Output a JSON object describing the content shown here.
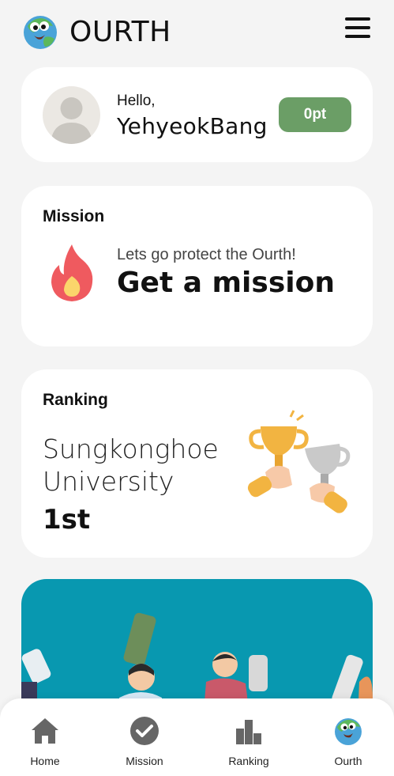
{
  "header": {
    "title": "OURTH",
    "logo_icon": "earth-mascot-icon",
    "menu_icon": "hamburger-menu-icon"
  },
  "profile": {
    "greeting": "Hello,",
    "username": "YehyeokBang",
    "points": "0pt",
    "avatar_icon": "default-avatar-icon"
  },
  "mission": {
    "heading": "Mission",
    "subtitle": "Lets go protect the Ourth!",
    "cta": "Get a mission",
    "icon": "fire-icon"
  },
  "ranking": {
    "heading": "Ranking",
    "school_line1": "Sungkonghoe",
    "school_line2": "University",
    "position": "1st",
    "icon": "trophies-icon"
  },
  "nav": {
    "items": [
      {
        "label": "Home",
        "icon": "home-icon"
      },
      {
        "label": "Mission",
        "icon": "check-circle-icon"
      },
      {
        "label": "Ranking",
        "icon": "ranking-bars-icon"
      },
      {
        "label": "Ourth",
        "icon": "earth-mascot-icon"
      }
    ]
  },
  "colors": {
    "background": "#f4f4f4",
    "accent_green": "#6b9e66",
    "banner_teal": "#0898b0",
    "card": "#ffffff"
  }
}
